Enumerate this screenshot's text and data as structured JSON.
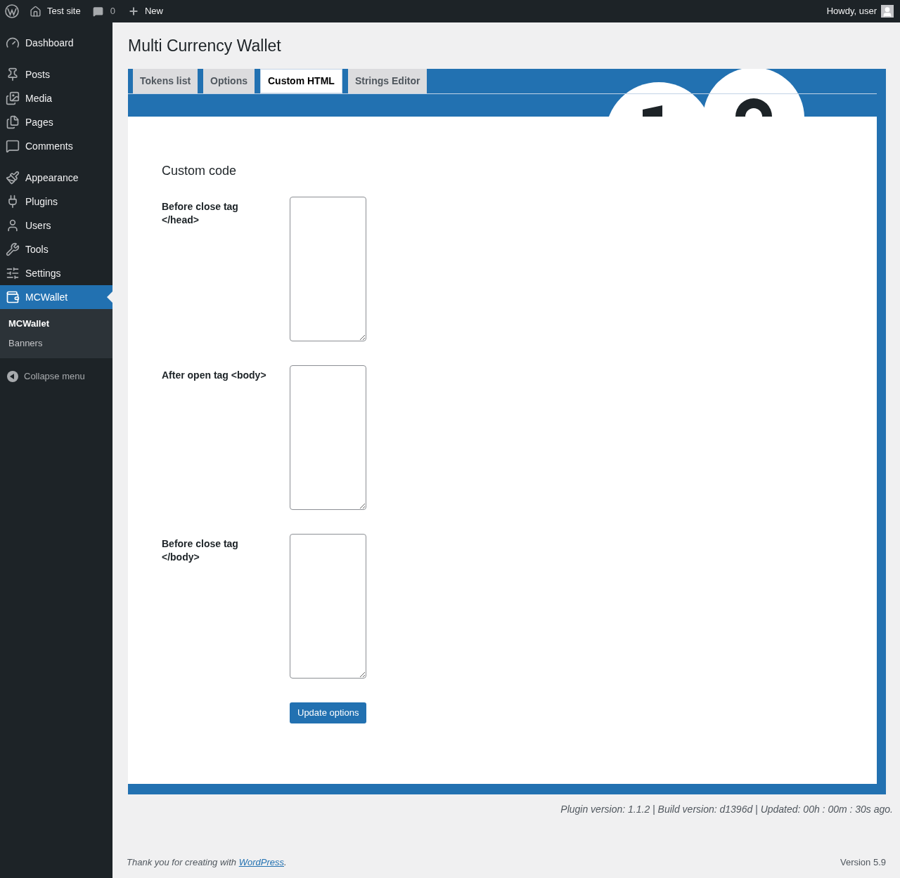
{
  "admin_bar": {
    "site_name": "Test site",
    "comments_count": "0",
    "new_label": "New",
    "greeting": "Howdy, user"
  },
  "sidebar": {
    "groups": [
      [
        {
          "label": "Dashboard",
          "selected": false
        }
      ],
      [
        {
          "label": "Posts",
          "selected": false
        },
        {
          "label": "Media",
          "selected": false
        },
        {
          "label": "Pages",
          "selected": false
        },
        {
          "label": "Comments",
          "selected": false
        }
      ],
      [
        {
          "label": "Appearance",
          "selected": false
        },
        {
          "label": "Plugins",
          "selected": false
        },
        {
          "label": "Users",
          "selected": false
        },
        {
          "label": "Tools",
          "selected": false
        },
        {
          "label": "Settings",
          "selected": false
        },
        {
          "label": "MCWallet",
          "selected": true
        }
      ]
    ],
    "submenu": [
      {
        "label": "MCWallet",
        "selected": true
      },
      {
        "label": "Banners",
        "selected": false
      }
    ],
    "collapse_label": "Collapse menu"
  },
  "page": {
    "title": "Multi Currency Wallet",
    "tabs": [
      {
        "label": "Tokens list",
        "selected": false
      },
      {
        "label": "Options",
        "selected": false
      },
      {
        "label": "Custom HTML",
        "selected": true
      },
      {
        "label": "Strings Editor",
        "selected": false
      }
    ],
    "section_title": "Custom code",
    "fields": [
      {
        "label": "Before close tag </head>"
      },
      {
        "label": "After open tag <body>"
      },
      {
        "label": "Before close tag </body>"
      }
    ],
    "submit_label": "Update options",
    "version_info": "Plugin version: 1.1.2 | Build version: d1396d | Updated: 00h : 00m : 30s ago."
  },
  "footer": {
    "thanks_prefix": "Thank you for creating with ",
    "link": "WordPress",
    "thanks_suffix": ".",
    "version": "Version 5.9"
  }
}
